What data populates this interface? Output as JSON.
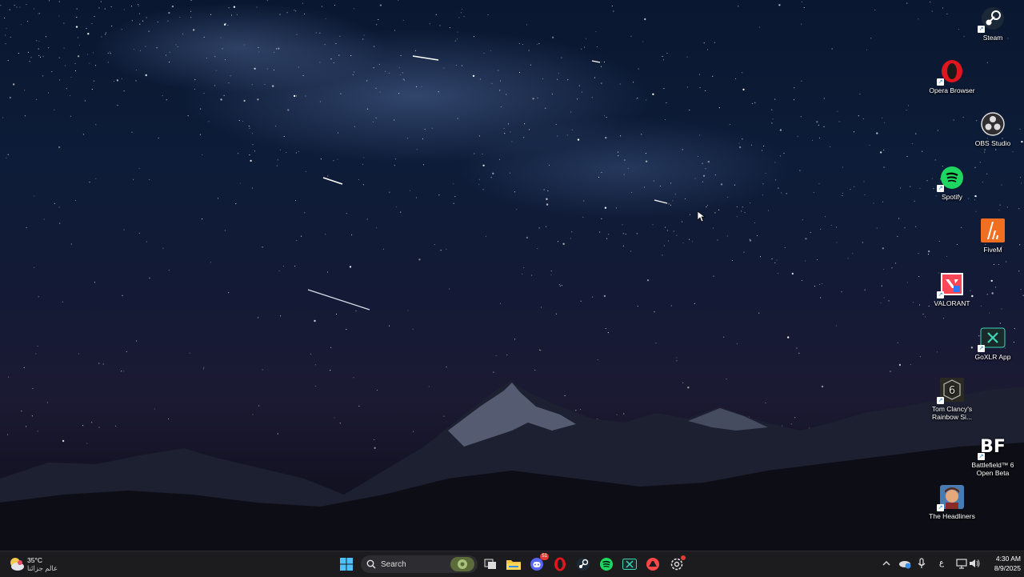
{
  "desktop": {
    "icons": [
      {
        "label": "Steam",
        "icon": "steam-icon"
      },
      {
        "label": "Opera Browser",
        "icon": "opera-icon"
      },
      {
        "label": "OBS Studio",
        "icon": "obs-icon"
      },
      {
        "label": "Spotify",
        "icon": "spotify-icon"
      },
      {
        "label": "FiveM",
        "icon": "fivem-icon"
      },
      {
        "label": "VALORANT",
        "icon": "valorant-icon"
      },
      {
        "label": "GoXLR App",
        "icon": "goxlr-icon"
      },
      {
        "label": "Tom Clancy's Rainbow Si...",
        "icon": "rainbow-six-icon"
      },
      {
        "label": "Battlefield™ 6 Open Beta",
        "icon": "battlefield-icon"
      },
      {
        "label": "The Headliners",
        "icon": "headliners-icon"
      }
    ]
  },
  "taskbar": {
    "weather": {
      "temp": "35°C",
      "caption": "عالم جزائنا"
    },
    "search_placeholder": "Search",
    "discord_badge": "51",
    "apps": [
      "start-icon",
      "search-icon",
      "task-view-icon",
      "file-explorer-icon",
      "discord-icon",
      "opera-icon",
      "steam-icon",
      "spotify-icon",
      "goxlr-icon",
      "ea-icon",
      "settings-icon"
    ],
    "tray": {
      "language": "ع",
      "time": "4:30 AM",
      "date": "8/9/2025"
    }
  },
  "colors": {
    "taskbar_bg": "#1c1c1f",
    "sky_top": "#0a1730",
    "spotify": "#1ed760",
    "opera": "#e0161e",
    "steam": "#1b2838"
  }
}
